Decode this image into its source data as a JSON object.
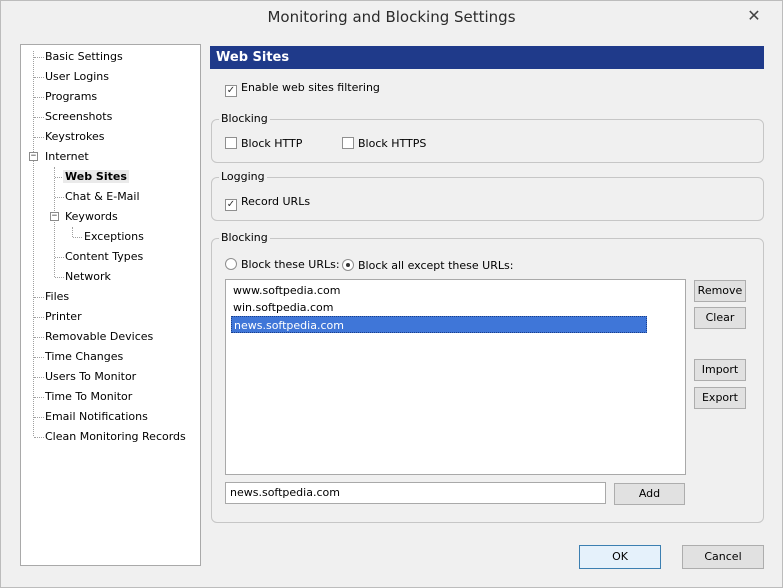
{
  "window": {
    "title": "Monitoring and Blocking Settings",
    "close_glyph": "✕"
  },
  "tree": {
    "items": [
      "Basic Settings",
      "User Logins",
      "Programs",
      "Screenshots",
      "Keystrokes",
      "Internet",
      "Web Sites",
      "Chat & E-Mail",
      "Keywords",
      "Exceptions",
      "Content Types",
      "Network",
      "Files",
      "Printer",
      "Removable Devices",
      "Time Changes",
      "Users To Monitor",
      "Time To Monitor",
      "Email Notifications",
      "Clean Monitoring Records"
    ],
    "selected": "Web Sites"
  },
  "panel": {
    "header": "Web Sites",
    "enable_filtering": {
      "label": "Enable web sites filtering",
      "checked": true
    },
    "blocking_group": {
      "label": "Blocking",
      "block_http": {
        "label": "Block HTTP",
        "checked": false
      },
      "block_https": {
        "label": "Block HTTPS",
        "checked": false
      }
    },
    "logging_group": {
      "label": "Logging",
      "record_urls": {
        "label": "Record URLs",
        "checked": true
      }
    },
    "url_group": {
      "label": "Blocking",
      "radio_block_these": {
        "label": "Block these URLs:",
        "selected": false
      },
      "radio_block_except": {
        "label": "Block all except these URLs:",
        "selected": true
      },
      "urls": [
        "www.softpedia.com",
        "win.softpedia.com",
        "news.softpedia.com"
      ],
      "selected_url": "news.softpedia.com",
      "input_value": "news.softpedia.com",
      "buttons": {
        "remove": "Remove",
        "clear": "Clear",
        "import": "Import",
        "export": "Export",
        "add": "Add"
      }
    }
  },
  "footer": {
    "ok": "OK",
    "cancel": "Cancel"
  },
  "colors": {
    "header_bg": "#1f3a8a",
    "selection_bg": "#3f76d8"
  },
  "icons": {
    "check": "✓",
    "collapse": "−"
  }
}
